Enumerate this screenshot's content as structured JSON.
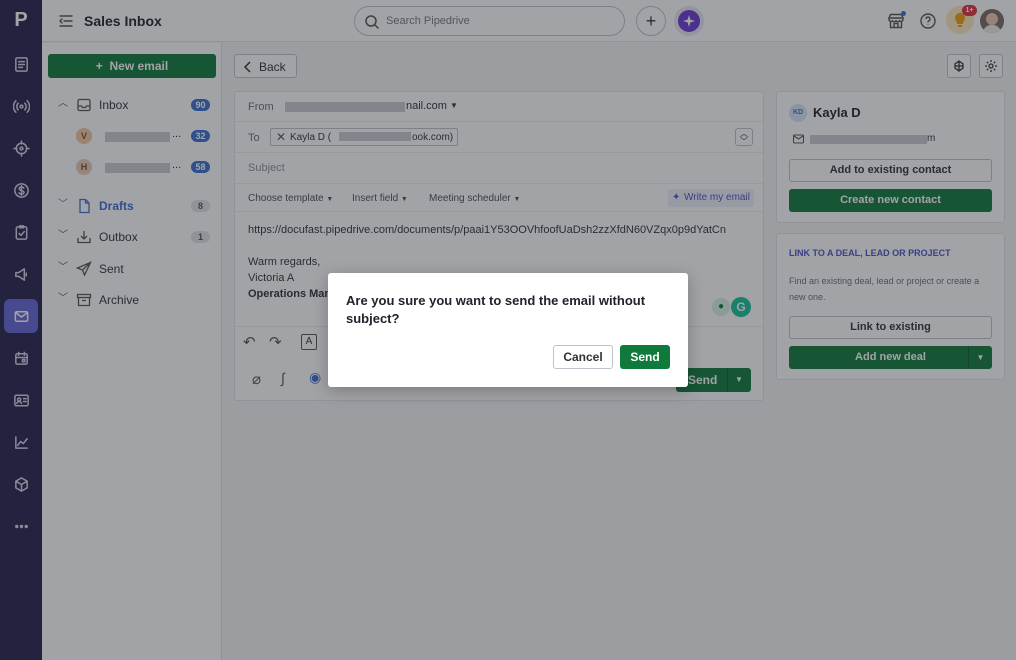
{
  "app": {
    "logo": "P",
    "title": "Sales Inbox"
  },
  "header": {
    "search_placeholder": "Search Pipedrive",
    "add_icon": "plus-icon",
    "notification_badge": "1+"
  },
  "sidebar": {
    "new_email_label": "New email",
    "inbox": {
      "label": "Inbox",
      "count": "90"
    },
    "accounts": [
      {
        "initial": "V",
        "name_suffix": "...",
        "count": "32"
      },
      {
        "initial": "H",
        "name_suffix": "...",
        "count": "58"
      }
    ],
    "drafts": {
      "label": "Drafts",
      "count": "8"
    },
    "outbox": {
      "label": "Outbox",
      "count": "1"
    },
    "sent": {
      "label": "Sent"
    },
    "archive": {
      "label": "Archive"
    }
  },
  "compose": {
    "back_label": "Back",
    "from_label": "From",
    "from_value_suffix": "nail.com",
    "to_label": "To",
    "to_chip_name": "Kayla D (",
    "to_chip_suffix": "ook.com)",
    "subject_placeholder": "Subject",
    "choose_template": "Choose template",
    "insert_field": "Insert field",
    "meeting_scheduler": "Meeting scheduler",
    "write_my_email": "Write my email",
    "body_link": "https://docufast.pipedrive.com/documents/p/paai1Y53OOVhfoofUaDsh2zzXfdN60VZqx0p9dYatCn",
    "body_regards": "Warm regards,",
    "body_name": "Victoria A",
    "body_title": "Operations Mana",
    "send_label": "Send"
  },
  "contact": {
    "initials": "KD",
    "name": "Kayla D",
    "email_suffix": "m",
    "add_existing": "Add to existing contact",
    "create_new": "Create new contact",
    "link_heading": "LINK TO A DEAL, LEAD OR PROJECT",
    "link_desc": "Find an existing deal, lead or project or create a new one.",
    "link_existing": "Link to existing",
    "add_new_deal": "Add new deal"
  },
  "modal": {
    "message": "Are you sure you want to send the email without subject?",
    "cancel_label": "Cancel",
    "send_label": "Send"
  },
  "colors": {
    "rail": "#27244f",
    "primary_green": "#0f7a3c",
    "accent_blue": "#3b6fd3",
    "accent_purple": "#4c54c4"
  }
}
